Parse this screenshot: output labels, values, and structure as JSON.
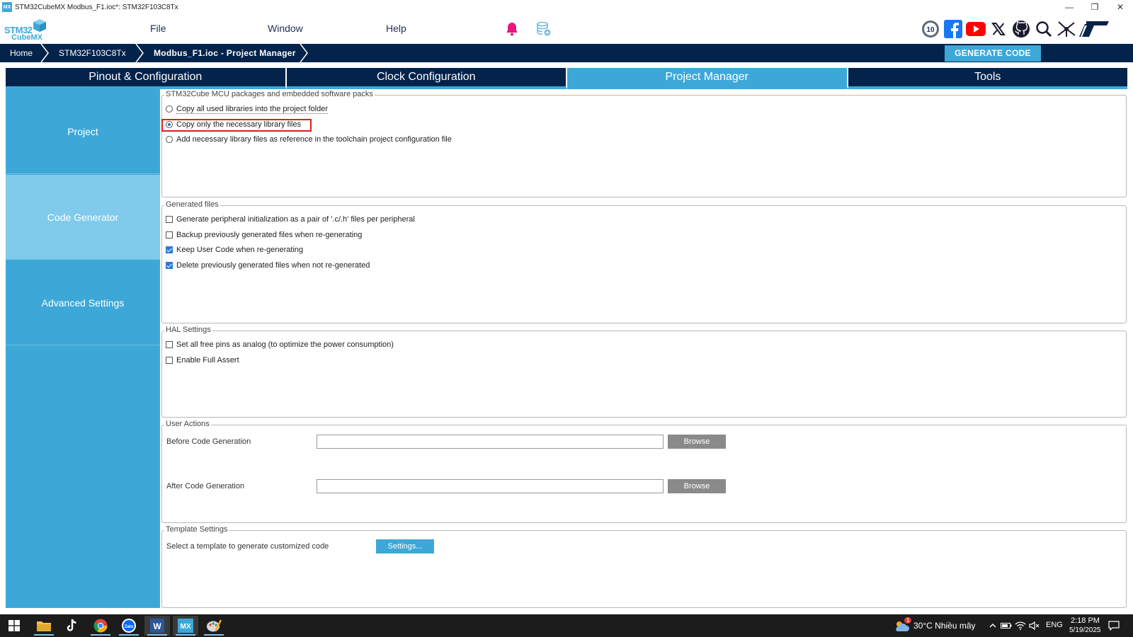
{
  "window": {
    "title": "STM32CubeMX Modbus_F1.ioc*: STM32F103C8Tx",
    "app_icon_text": "MX",
    "minimize": "—",
    "restore": "❐",
    "close": "✕"
  },
  "logo": {
    "line1": "STM32",
    "line2": "CubeMX"
  },
  "menu": {
    "file": "File",
    "window": "Window",
    "help": "Help"
  },
  "breadcrumb": {
    "home": "Home",
    "device": "STM32F103C8Tx",
    "current": "Modbus_F1.ioc - Project Manager"
  },
  "generate_button": "GENERATE CODE",
  "tabs": [
    {
      "label": "Pinout & Configuration",
      "active": false
    },
    {
      "label": "Clock Configuration",
      "active": false
    },
    {
      "label": "Project Manager",
      "active": true
    },
    {
      "label": "Tools",
      "active": false
    }
  ],
  "sidenav": [
    {
      "label": "Project",
      "active": false
    },
    {
      "label": "Code Generator",
      "active": true
    },
    {
      "label": "Advanced Settings",
      "active": false
    }
  ],
  "packages": {
    "title": "STM32Cube MCU packages and embedded software packs",
    "options": [
      {
        "label": "Copy all used libraries into the project folder",
        "selected": false
      },
      {
        "label": "Copy only the necessary library files",
        "selected": true
      },
      {
        "label": "Add necessary library files as reference in the toolchain project configuration file",
        "selected": false
      }
    ]
  },
  "generated_files": {
    "title": "Generated files",
    "options": [
      {
        "label": "Generate peripheral initialization as a pair of '.c/.h' files per peripheral",
        "checked": false
      },
      {
        "label": "Backup previously generated files when re-generating",
        "checked": false
      },
      {
        "label": "Keep User Code when re-generating",
        "checked": true
      },
      {
        "label": "Delete previously generated files when not re-generated",
        "checked": true
      }
    ]
  },
  "hal_settings": {
    "title": "HAL Settings",
    "options": [
      {
        "label": "Set all free pins as analog (to optimize the power consumption)",
        "checked": false
      },
      {
        "label": "Enable Full Assert",
        "checked": false
      }
    ]
  },
  "user_actions": {
    "title": "User Actions",
    "before_label": "Before Code Generation",
    "before_value": "",
    "after_label": "After Code Generation",
    "after_value": "",
    "browse": "Browse"
  },
  "template_settings": {
    "title": "Template Settings",
    "label": "Select a template to generate customized code",
    "button": "Settings..."
  },
  "taskbar": {
    "weather": "30°C  Nhiều mây",
    "weather_badge": "1",
    "language": "ENG",
    "time": "2:18 PM",
    "date": "5/19/2025",
    "zalo": "Zalo",
    "word": "W",
    "mx": "MX"
  },
  "colors": {
    "navy": "#03234b",
    "accent": "#3da8d8",
    "highlight": "#e01d1d"
  }
}
